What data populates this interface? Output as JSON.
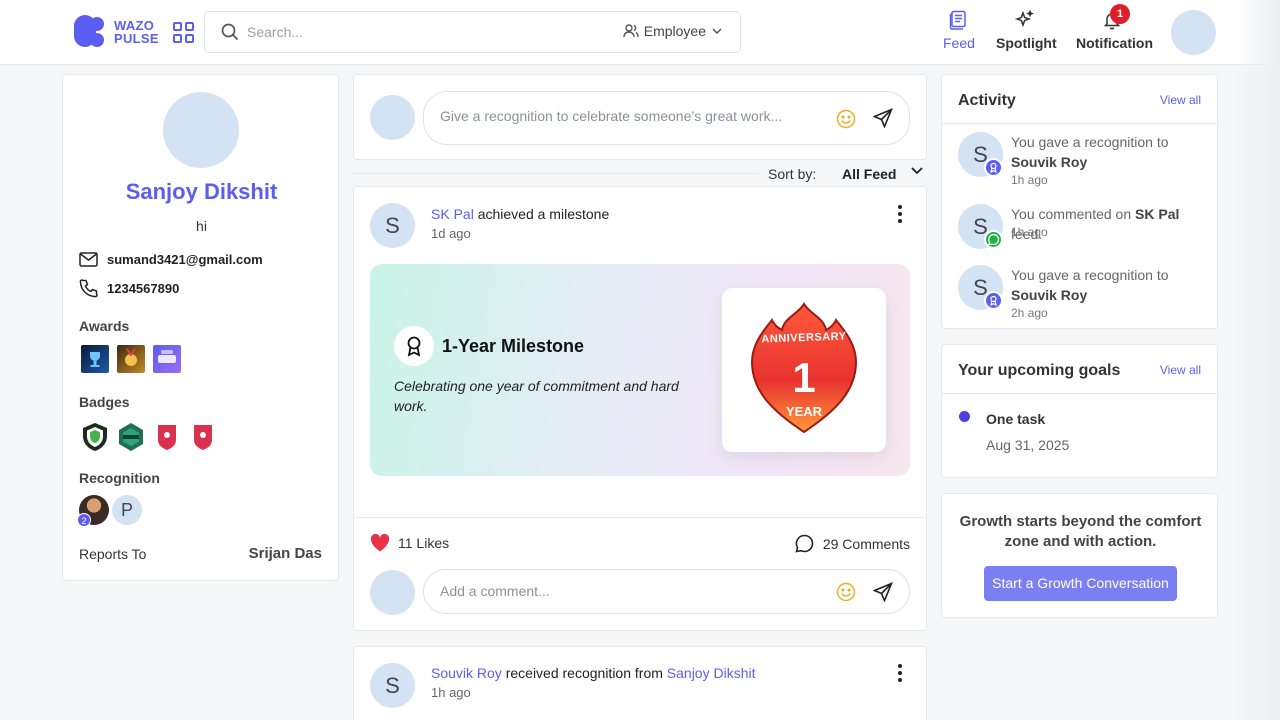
{
  "app": {
    "logo_line1": "WAZO",
    "logo_line2": "PULSE"
  },
  "header": {
    "search_placeholder": "Search...",
    "filter_label": "Employee",
    "nav": [
      {
        "label": "Feed",
        "icon": "feed-icon",
        "active": true
      },
      {
        "label": "Spotlight",
        "icon": "spotlight-icon",
        "active": false
      },
      {
        "label": "Notification",
        "icon": "bell-icon",
        "active": false,
        "badge": "1"
      }
    ]
  },
  "profile": {
    "name": "Sanjoy Dikshit",
    "bio": "hi",
    "email": "sumand3421@gmail.com",
    "phone": "1234567890",
    "awards_label": "Awards",
    "badges_label": "Badges",
    "recognition_label": "Recognition",
    "recognition_avatars": [
      "photo",
      "P"
    ],
    "recognition_count": "2",
    "reports_to_label": "Reports To",
    "reports_to_value": "Srijan Das"
  },
  "composer": {
    "placeholder": "Give a recognition to celebrate someone’s great work..."
  },
  "sort": {
    "label": "Sort by:",
    "value": "All Feed"
  },
  "posts": [
    {
      "avatar": "S",
      "author": "SK Pal",
      "action": "achieved a milestone",
      "time": "1d ago",
      "milestone_title": "1-Year Milestone",
      "milestone_desc": "Celebrating one year of commitment and hard work.",
      "badge_top": "ANNIVERSARY",
      "badge_number": "1",
      "badge_bottom": "YEAR",
      "likes": "11 Likes",
      "comments": "29 Comments",
      "comment_placeholder": "Add a comment..."
    },
    {
      "avatar": "S",
      "author": "Souvik Roy",
      "action": "received recognition from",
      "target": "Sanjoy Dikshit",
      "time": "1h ago"
    }
  ],
  "activity": {
    "title": "Activity",
    "view_all": "View all",
    "items": [
      {
        "avatar": "S",
        "pre": "You gave a recognition to ",
        "bold": "Souvik Roy",
        "post": "",
        "time": "1h ago",
        "icon": "recognition-icon"
      },
      {
        "avatar": "S",
        "pre": "You commented on ",
        "bold": "SK Pal",
        "post": " feed.",
        "time": "1h ago",
        "icon": "comment-icon"
      },
      {
        "avatar": "S",
        "pre": "You gave a recognition to ",
        "bold": "Souvik Roy",
        "post": "",
        "time": "2h ago",
        "icon": "recognition-icon"
      }
    ]
  },
  "goals": {
    "title": "Your upcoming goals",
    "view_all": "View all",
    "items": [
      {
        "name": "One task",
        "date": "Aug 31, 2025"
      }
    ]
  },
  "growth": {
    "text": "Growth starts beyond the comfort zone and with action.",
    "button": "Start a Growth Conversation"
  },
  "colors": {
    "accent": "#5b5ef0",
    "like": "#e8324a",
    "notification_badge": "#e11d2a"
  }
}
